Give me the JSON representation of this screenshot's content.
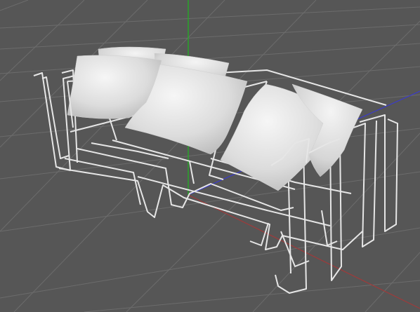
{
  "viewport": {
    "background_color": "#565656",
    "grid_color": "#6c6c6c",
    "axis_colors": {
      "x": "#a03a3a",
      "y": "#22b022",
      "z": "#3a3ad0"
    },
    "show_grid": true
  },
  "scene": {
    "object": "sofa",
    "wire_color": "#e6e6e6",
    "cushion_color": "#e8e8e8",
    "cushion_count": 6
  }
}
